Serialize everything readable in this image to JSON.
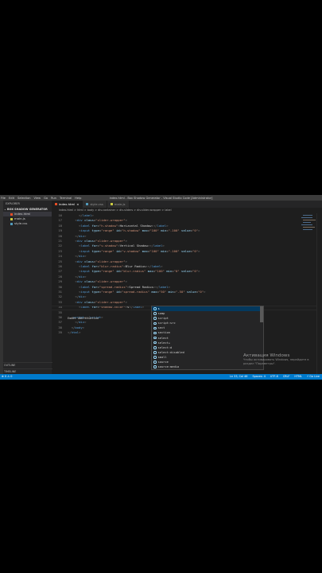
{
  "titlebar": {
    "menu": [
      "File",
      "Edit",
      "Selection",
      "View",
      "Go",
      "Run",
      "Terminal",
      "Help"
    ],
    "window_title": "index.html - Box Shadow Generator - Visual Studio Code [Administrator]"
  },
  "sidebar": {
    "header": "EXPLORER",
    "folder": "BOX SHADOW GENERATOR",
    "files": [
      {
        "name": "index.html",
        "color": "#e44d26",
        "active": true
      },
      {
        "name": "main.js",
        "color": "#cbcb41",
        "active": false
      },
      {
        "name": "style.css",
        "color": "#519aba",
        "active": false
      }
    ],
    "outline": "OUTLINE",
    "timeline": "TIMELINE"
  },
  "tabs": [
    {
      "label": "index.html",
      "color": "#e44d26",
      "active": true,
      "close": "×"
    },
    {
      "label": "style.css",
      "color": "#519aba",
      "active": false,
      "close": ""
    },
    {
      "label": "main.js",
      "color": "#cbcb41",
      "active": false,
      "close": ""
    }
  ],
  "breadcrumb": "index.html > html > body > div.container > div.sliders > div.slider-wrapper > label",
  "code_lines": [
    {
      "n": "16",
      "i": 6,
      "parts": [
        [
          "p",
          "</"
        ],
        [
          "t",
          "label"
        ],
        [
          "p",
          ">"
        ]
      ]
    },
    {
      "n": "17",
      "i": 4,
      "parts": [
        [
          "p",
          "<"
        ],
        [
          "t",
          "div"
        ],
        [
          "x",
          " "
        ],
        [
          "a",
          "class"
        ],
        [
          "x",
          "="
        ],
        [
          "s",
          "\"slider-wrapper\""
        ],
        [
          "p",
          ">"
        ]
      ]
    },
    {
      "n": "18",
      "i": 6,
      "parts": [
        [
          "p",
          "<"
        ],
        [
          "t",
          "label"
        ],
        [
          "x",
          " "
        ],
        [
          "a",
          "for"
        ],
        [
          "x",
          "="
        ],
        [
          "s",
          "\"h-shadow\""
        ],
        [
          "p",
          ">"
        ],
        [
          "x",
          "Horizontal Shadow:"
        ],
        [
          "p",
          "</"
        ],
        [
          "t",
          "label"
        ],
        [
          "p",
          ">"
        ]
      ]
    },
    {
      "n": "19",
      "i": 6,
      "parts": [
        [
          "p",
          "<"
        ],
        [
          "t",
          "input"
        ],
        [
          "x",
          " "
        ],
        [
          "a",
          "type"
        ],
        [
          "x",
          "="
        ],
        [
          "s",
          "\"range\""
        ],
        [
          "x",
          " "
        ],
        [
          "a",
          "id"
        ],
        [
          "x",
          "="
        ],
        [
          "s",
          "\"h-shadow\""
        ],
        [
          "x",
          " "
        ],
        [
          "a",
          "max"
        ],
        [
          "x",
          "="
        ],
        [
          "s",
          "\"100\""
        ],
        [
          "x",
          " "
        ],
        [
          "a",
          "min"
        ],
        [
          "x",
          "="
        ],
        [
          "s",
          "\"-100\""
        ],
        [
          "x",
          " "
        ],
        [
          "a",
          "value"
        ],
        [
          "x",
          "="
        ],
        [
          "s",
          "\"0\""
        ],
        [
          "p",
          ">"
        ]
      ]
    },
    {
      "n": "20",
      "i": 4,
      "parts": [
        [
          "p",
          "</"
        ],
        [
          "t",
          "div"
        ],
        [
          "p",
          ">"
        ]
      ]
    },
    {
      "n": "21",
      "i": 4,
      "parts": [
        [
          "p",
          "<"
        ],
        [
          "t",
          "div"
        ],
        [
          "x",
          " "
        ],
        [
          "a",
          "class"
        ],
        [
          "x",
          "="
        ],
        [
          "s",
          "\"slider-wrapper\""
        ],
        [
          "p",
          ">"
        ]
      ]
    },
    {
      "n": "22",
      "i": 6,
      "parts": [
        [
          "p",
          "<"
        ],
        [
          "t",
          "label"
        ],
        [
          "x",
          " "
        ],
        [
          "a",
          "for"
        ],
        [
          "x",
          "="
        ],
        [
          "s",
          "\"v-shadow\""
        ],
        [
          "p",
          ">"
        ],
        [
          "x",
          "Vertical Shadow:"
        ],
        [
          "p",
          "</"
        ],
        [
          "t",
          "label"
        ],
        [
          "p",
          ">"
        ]
      ]
    },
    {
      "n": "23",
      "i": 6,
      "parts": [
        [
          "p",
          "<"
        ],
        [
          "t",
          "input"
        ],
        [
          "x",
          " "
        ],
        [
          "a",
          "type"
        ],
        [
          "x",
          "="
        ],
        [
          "s",
          "\"range\""
        ],
        [
          "x",
          " "
        ],
        [
          "a",
          "id"
        ],
        [
          "x",
          "="
        ],
        [
          "s",
          "\"v-shadow\""
        ],
        [
          "x",
          " "
        ],
        [
          "a",
          "max"
        ],
        [
          "x",
          "="
        ],
        [
          "s",
          "\"100\""
        ],
        [
          "x",
          " "
        ],
        [
          "a",
          "min"
        ],
        [
          "x",
          "="
        ],
        [
          "s",
          "\"-100\""
        ],
        [
          "x",
          " "
        ],
        [
          "a",
          "value"
        ],
        [
          "x",
          "="
        ],
        [
          "s",
          "\"0\""
        ],
        [
          "p",
          ">"
        ]
      ]
    },
    {
      "n": "24",
      "i": 4,
      "parts": [
        [
          "p",
          "</"
        ],
        [
          "t",
          "div"
        ],
        [
          "p",
          ">"
        ]
      ]
    },
    {
      "n": "25",
      "i": 4,
      "parts": [
        [
          "p",
          "<"
        ],
        [
          "t",
          "div"
        ],
        [
          "x",
          " "
        ],
        [
          "a",
          "class"
        ],
        [
          "x",
          "="
        ],
        [
          "s",
          "\"slider-wrapper\""
        ],
        [
          "p",
          ">"
        ]
      ]
    },
    {
      "n": "26",
      "i": 6,
      "parts": [
        [
          "p",
          "<"
        ],
        [
          "t",
          "label"
        ],
        [
          "x",
          " "
        ],
        [
          "a",
          "for"
        ],
        [
          "x",
          "="
        ],
        [
          "s",
          "\"blur-radius\""
        ],
        [
          "p",
          ">"
        ],
        [
          "x",
          "Blur Radius:"
        ],
        [
          "p",
          "</"
        ],
        [
          "t",
          "label"
        ],
        [
          "p",
          ">"
        ]
      ]
    },
    {
      "n": "27",
      "i": 6,
      "parts": [
        [
          "p",
          "<"
        ],
        [
          "t",
          "input"
        ],
        [
          "x",
          " "
        ],
        [
          "a",
          "type"
        ],
        [
          "x",
          "="
        ],
        [
          "s",
          "\"range\""
        ],
        [
          "x",
          " "
        ],
        [
          "a",
          "id"
        ],
        [
          "x",
          "="
        ],
        [
          "s",
          "\"blur-radius\""
        ],
        [
          "x",
          " "
        ],
        [
          "a",
          "max"
        ],
        [
          "x",
          "="
        ],
        [
          "s",
          "\"100\""
        ],
        [
          "x",
          " "
        ],
        [
          "a",
          "min"
        ],
        [
          "x",
          "="
        ],
        [
          "s",
          "\"0\""
        ],
        [
          "x",
          " "
        ],
        [
          "a",
          "value"
        ],
        [
          "x",
          "="
        ],
        [
          "s",
          "\"0\""
        ],
        [
          "p",
          ">"
        ]
      ]
    },
    {
      "n": "28",
      "i": 4,
      "parts": [
        [
          "p",
          "</"
        ],
        [
          "t",
          "div"
        ],
        [
          "p",
          ">"
        ]
      ]
    },
    {
      "n": "29",
      "i": 4,
      "parts": [
        [
          "p",
          "<"
        ],
        [
          "t",
          "div"
        ],
        [
          "x",
          " "
        ],
        [
          "a",
          "class"
        ],
        [
          "x",
          "="
        ],
        [
          "s",
          "\"slider-wrapper\""
        ],
        [
          "p",
          ">"
        ]
      ]
    },
    {
      "n": "30",
      "i": 6,
      "parts": [
        [
          "p",
          "<"
        ],
        [
          "t",
          "label"
        ],
        [
          "x",
          " "
        ],
        [
          "a",
          "for"
        ],
        [
          "x",
          "="
        ],
        [
          "s",
          "\"spread-radius\""
        ],
        [
          "p",
          ">"
        ],
        [
          "x",
          "Spread Radius:"
        ],
        [
          "p",
          "</"
        ],
        [
          "t",
          "label"
        ],
        [
          "p",
          ">"
        ]
      ]
    },
    {
      "n": "31",
      "i": 6,
      "parts": [
        [
          "p",
          "<"
        ],
        [
          "t",
          "input"
        ],
        [
          "x",
          " "
        ],
        [
          "a",
          "type"
        ],
        [
          "x",
          "="
        ],
        [
          "s",
          "\"range\""
        ],
        [
          "x",
          " "
        ],
        [
          "a",
          "id"
        ],
        [
          "x",
          "="
        ],
        [
          "s",
          "\"spread-radius\""
        ],
        [
          "x",
          " "
        ],
        [
          "a",
          "max"
        ],
        [
          "x",
          "="
        ],
        [
          "s",
          "\"50\""
        ],
        [
          "x",
          " "
        ],
        [
          "a",
          "min"
        ],
        [
          "x",
          "="
        ],
        [
          "s",
          "\"-50\""
        ],
        [
          "x",
          " "
        ],
        [
          "a",
          "value"
        ],
        [
          "x",
          "="
        ],
        [
          "s",
          "\"0\""
        ],
        [
          "p",
          ">"
        ]
      ]
    },
    {
      "n": "32",
      "i": 4,
      "parts": [
        [
          "p",
          "</"
        ],
        [
          "t",
          "div"
        ],
        [
          "p",
          ">"
        ]
      ]
    },
    {
      "n": "33",
      "i": 4,
      "parts": [
        [
          "p",
          "<"
        ],
        [
          "t",
          "div"
        ],
        [
          "x",
          " "
        ],
        [
          "a",
          "class"
        ],
        [
          "x",
          "="
        ],
        [
          "s",
          "\"slider-wrapper\""
        ],
        [
          "p",
          ">"
        ]
      ]
    },
    {
      "n": "34",
      "i": 6,
      "parts": [
        [
          "p",
          "<"
        ],
        [
          "t",
          "label"
        ],
        [
          "x",
          " "
        ],
        [
          "a",
          "for"
        ],
        [
          "x",
          "="
        ],
        [
          "s",
          "\"shadow-color\""
        ],
        [
          "p",
          ">"
        ],
        [
          "x",
          "s"
        ],
        [
          "p",
          "</"
        ],
        [
          "t",
          "label"
        ],
        [
          "p",
          ">"
        ]
      ]
    },
    {
      "n": "35",
      "i": 0,
      "parts": []
    },
    {
      "n": "36",
      "i": 2,
      "parts": [
        [
          "p",
          "<"
        ],
        [
          "t",
          "script"
        ],
        [
          "p",
          ">"
        ],
        [
          "p",
          "</"
        ],
        [
          "t",
          "script"
        ],
        [
          "p",
          ">"
        ]
      ]
    },
    {
      "n": "37",
      "i": 4,
      "parts": [
        [
          "p",
          "</"
        ],
        [
          "t",
          "div"
        ],
        [
          "p",
          ">"
        ]
      ]
    },
    {
      "n": "38",
      "i": 2,
      "parts": [
        [
          "p",
          "</"
        ],
        [
          "t",
          "body"
        ],
        [
          "p",
          ">"
        ]
      ]
    },
    {
      "n": "39",
      "i": 0,
      "parts": [
        [
          "p",
          "</"
        ],
        [
          "t",
          "html"
        ],
        [
          "p",
          ">"
        ]
      ]
    }
  ],
  "emmet_hint": "Emmet Abbreviation",
  "suggestions": [
    "s",
    "samp",
    "script",
    "script:src",
    "sect",
    "section",
    "select",
    "select+",
    "select:d",
    "select:disabled",
    "small",
    "source",
    "source:media"
  ],
  "watermark": {
    "title": "Активация Windows",
    "line1": "Чтобы активировать Windows, перейдите в",
    "line2": "раздел \"Параметры\"."
  },
  "status": {
    "left": "⊗ 0 ⚠ 0",
    "right": [
      "Ln 33, Col 46",
      "Spaces: 4",
      "UTF-8",
      "CRLF",
      "HTML",
      "⚡ Go Live"
    ]
  }
}
